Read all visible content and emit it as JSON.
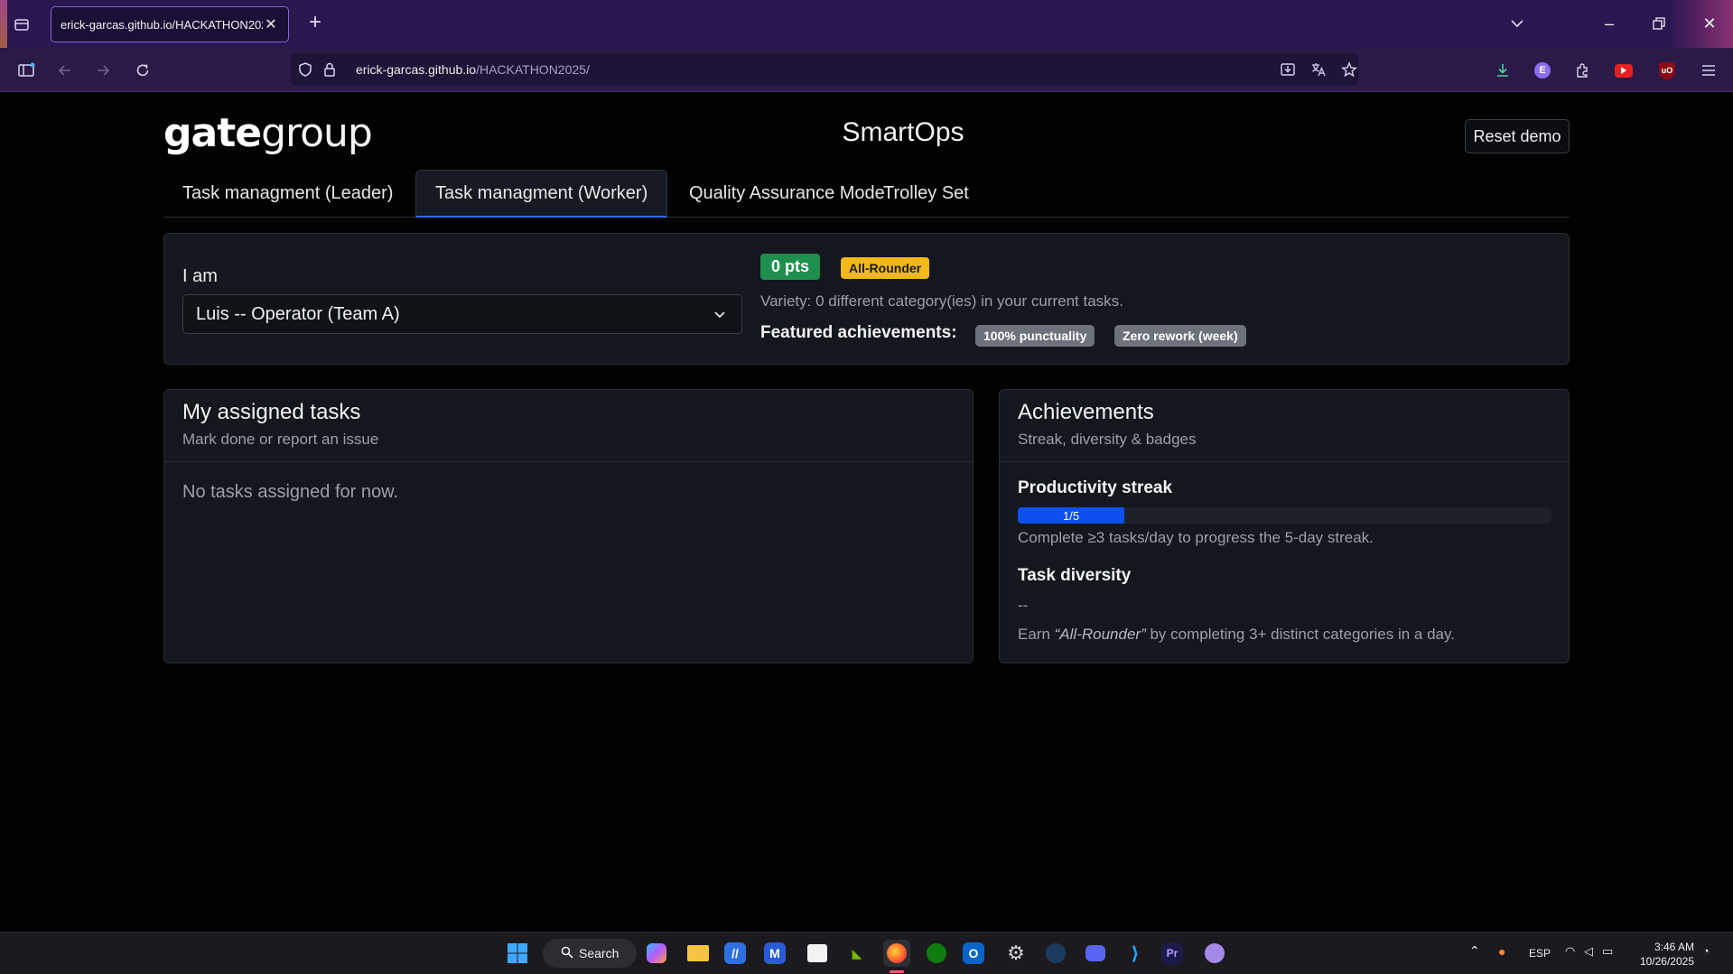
{
  "browser": {
    "tab_title": "erick-garcas.github.io/HACKATHON2025/",
    "url_host": "erick-garcas.github.io",
    "url_path": "/HACKATHON2025/"
  },
  "header": {
    "logo_bold": "gate",
    "logo_light": "group",
    "app_title": "SmartOps",
    "reset_label": "Reset demo"
  },
  "tabs": [
    {
      "label": "Task managment (Leader)",
      "active": false
    },
    {
      "label": "Task managment (Worker)",
      "active": true
    },
    {
      "label": "Quality Assurance Mode",
      "active": false
    },
    {
      "label": "Trolley Set",
      "active": false
    }
  ],
  "profile": {
    "iam_label": "I am",
    "selected_user": "Luis -- Operator (Team A)",
    "points": "0 pts",
    "rank_badge": "All-Rounder",
    "variety_text": "Variety: 0 different category(ies) in your current tasks.",
    "featured_label": "Featured achievements:",
    "featured": [
      "100% punctuality",
      "Zero rework (week)"
    ]
  },
  "tasks_card": {
    "title": "My assigned tasks",
    "subtitle": "Mark done or report an issue",
    "empty_text": "No tasks assigned for now."
  },
  "achievements_card": {
    "title": "Achievements",
    "subtitle": "Streak, diversity & badges",
    "streak_title": "Productivity streak",
    "streak_label": "1/5",
    "streak_value": 1,
    "streak_max": 5,
    "streak_note": "Complete ≥3 tasks/day to progress the 5-day streak.",
    "diversity_title": "Task diversity",
    "diversity_value": "--",
    "diversity_note_pre": "Earn ",
    "diversity_note_em": "“All-Rounder”",
    "diversity_note_post": " by completing 3+ distinct categories in a day."
  },
  "taskbar": {
    "search_label": "Search",
    "lang": "ESP",
    "time": "3:46 AM",
    "date": "10/26/2025"
  },
  "colors": {
    "accent_blue": "#0d4ff0",
    "points_green": "#1f8f4e",
    "rank_yellow": "#f3b81a",
    "badge_gray": "#6c737d"
  }
}
